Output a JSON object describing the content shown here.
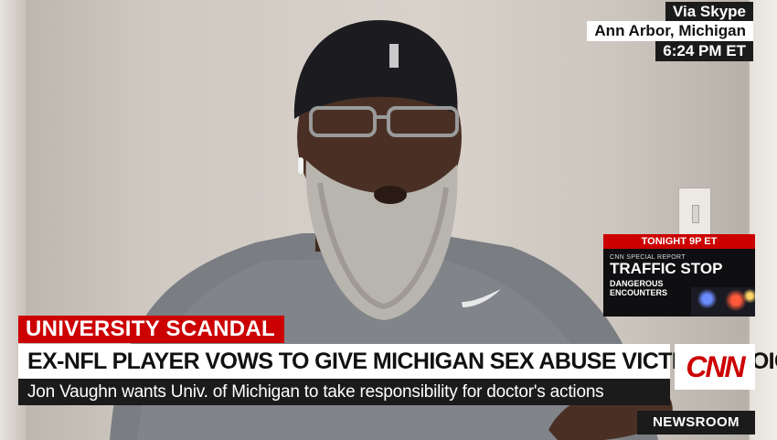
{
  "location": {
    "line1": "Via Skype",
    "line2": "Ann Arbor, Michigan",
    "time": "6:24 PM ET"
  },
  "promo": {
    "time": "TONIGHT 9P ET",
    "kicker": "CNN SPECIAL REPORT",
    "title": "TRAFFIC STOP",
    "subtitle": "DANGEROUS ENCOUNTERS"
  },
  "lower_third": {
    "kicker": "UNIVERSITY SCANDAL",
    "headline": "EX-NFL PLAYER VOWS TO GIVE MICHIGAN SEX ABUSE VICTIMS A VOICE",
    "subheadline": "Jon Vaughn wants Univ. of Michigan to take responsibility for doctor's actions"
  },
  "network": {
    "logo": "CNN"
  },
  "show_name": "NEWSROOM",
  "colors": {
    "brand_red": "#cc0000",
    "bar_dark": "#1b1b1b",
    "bar_light": "#ffffff"
  }
}
